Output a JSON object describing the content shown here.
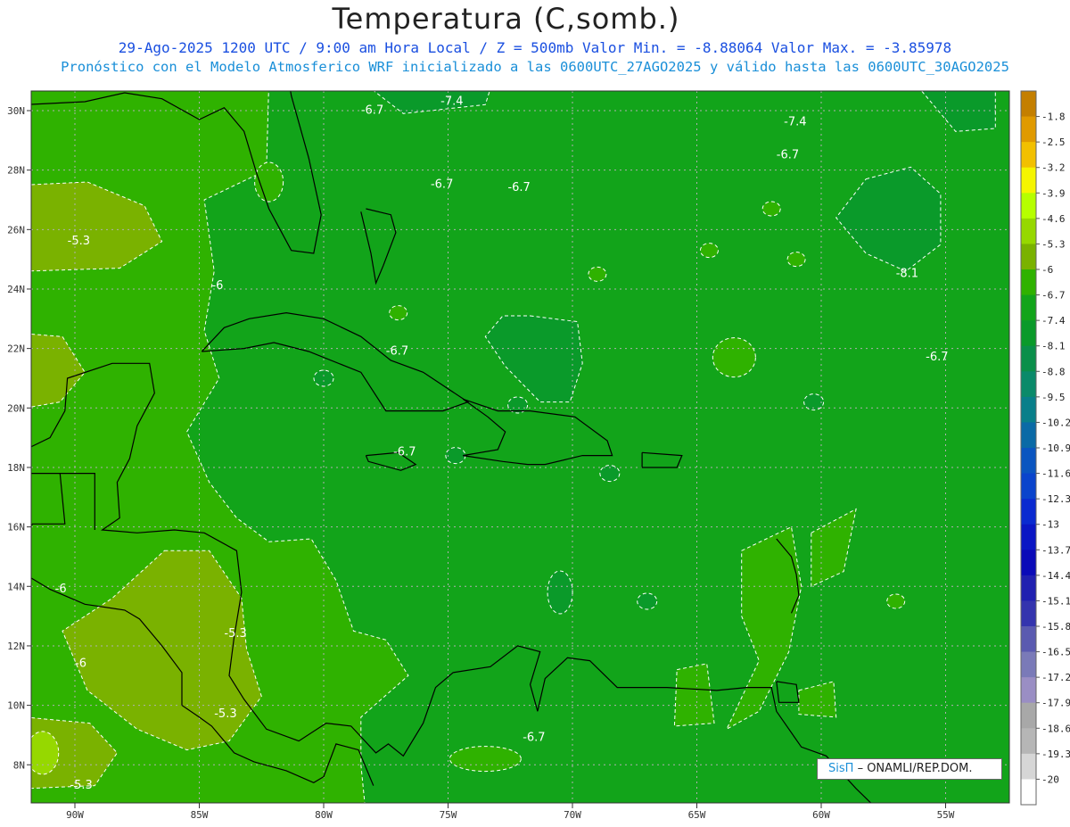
{
  "header": {
    "title": "Temperatura (C,somb.)",
    "line1": "29-Ago-2025  1200 UTC / 9:00 am Hora Local / Z = 500mb  Valor Min. = -8.88064  Valor Max. = -3.85978",
    "line2": "Pronóstico con el Modelo Atmosferico WRF inicializado a las 0600UTC_27AGO2025 y válido hasta las  0600UTC_30AGO2025"
  },
  "map": {
    "lat_labels": [
      "30N",
      "28N",
      "26N",
      "24N",
      "22N",
      "20N",
      "18N",
      "16N",
      "14N",
      "12N",
      "10N",
      "8N"
    ],
    "lon_labels": [
      "90W",
      "85W",
      "80W",
      "75W",
      "70W",
      "65W",
      "60W",
      "55W"
    ],
    "contour_labels": [
      {
        "text": "-7.4",
        "lon": -75.3,
        "lat": 30.2
      },
      {
        "text": "-6.7",
        "lon": -78.5,
        "lat": 29.9
      },
      {
        "text": "-7.4",
        "lon": -61.5,
        "lat": 29.5
      },
      {
        "text": "-6.7",
        "lon": -61.8,
        "lat": 28.4
      },
      {
        "text": "-6.7",
        "lon": -75.7,
        "lat": 27.4
      },
      {
        "text": "-6.7",
        "lon": -72.6,
        "lat": 27.3
      },
      {
        "text": "-5.3",
        "lon": -90.3,
        "lat": 25.5
      },
      {
        "text": "-8.1",
        "lon": -57.0,
        "lat": 24.4
      },
      {
        "text": "-6",
        "lon": -84.5,
        "lat": 24.0
      },
      {
        "text": "-6.7",
        "lon": -77.5,
        "lat": 21.8
      },
      {
        "text": "-6.7",
        "lon": -55.8,
        "lat": 21.6
      },
      {
        "text": "-6.7",
        "lon": -77.2,
        "lat": 18.4
      },
      {
        "text": "-6",
        "lon": -90.8,
        "lat": 13.8
      },
      {
        "text": "-5.3",
        "lon": -84.0,
        "lat": 12.3
      },
      {
        "text": "-6",
        "lon": -90.0,
        "lat": 11.3
      },
      {
        "text": "-5.3",
        "lon": -84.4,
        "lat": 9.6
      },
      {
        "text": "-6.7",
        "lon": -72.0,
        "lat": 8.8
      },
      {
        "text": "-5.3",
        "lon": -90.2,
        "lat": 7.2
      }
    ]
  },
  "colorbar": {
    "labels": [
      "-1.8",
      "-2.5",
      "-3.2",
      "-3.9",
      "-4.6",
      "-5.3",
      "-6",
      "-6.7",
      "-7.4",
      "-8.1",
      "-8.8",
      "-9.5",
      "-10.2",
      "-10.9",
      "-11.6",
      "-12.3",
      "-13",
      "-13.7",
      "-14.4",
      "-15.1",
      "-15.8",
      "-16.5",
      "-17.2",
      "-17.9",
      "-18.6",
      "-19.3",
      "-20"
    ],
    "colors": [
      "#c47f00",
      "#e09a00",
      "#f2c000",
      "#f5f500",
      "#b6ff00",
      "#96d800",
      "#7ab200",
      "#2fb200",
      "#12a41a",
      "#0a9a2a",
      "#0a8f4a",
      "#0a8a6a",
      "#087f8a",
      "#0a6aa6",
      "#0a55c0",
      "#0a44cc",
      "#0a2ad0",
      "#0a16c4",
      "#0a0ab8",
      "#2020b0",
      "#3434ae",
      "#5a5ab0",
      "#7a7ab8",
      "#9a8ec4",
      "#a8a8a8",
      "#b6b6b6",
      "#d6d6d6",
      "#ffffff"
    ]
  },
  "credit": {
    "brand": "SisΠ",
    "text": "– ONAMLI/REP.DOM."
  }
}
